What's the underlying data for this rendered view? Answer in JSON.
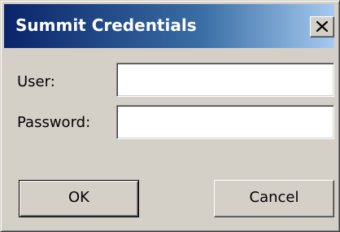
{
  "window": {
    "title": "Summit Credentials",
    "close_label": "X",
    "close_icon": "close-icon"
  },
  "form": {
    "user_label": "User:",
    "user_value": "",
    "password_label": "Password:",
    "password_value": ""
  },
  "buttons": {
    "ok_label": "OK",
    "cancel_label": "Cancel"
  },
  "colors": {
    "titlebar_start": "#0a246a",
    "titlebar_end": "#a6caf0",
    "face": "#d4d0c8"
  }
}
